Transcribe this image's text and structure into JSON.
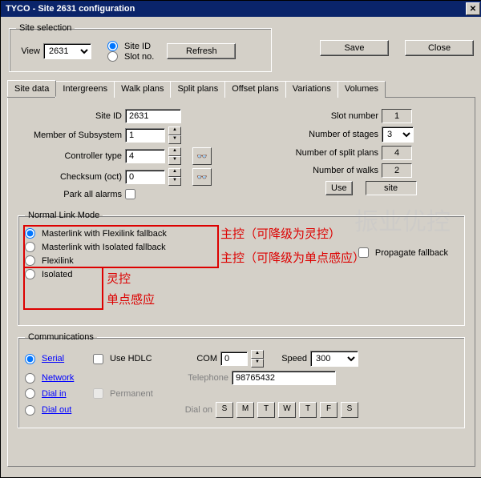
{
  "title": "TYCO - Site 2631 configuration",
  "site_selection": {
    "legend": "Site selection",
    "view_label": "View",
    "view_value": "2631",
    "siteid_label": "Site ID",
    "slotno_label": "Slot no.",
    "refresh": "Refresh"
  },
  "save": "Save",
  "close": "Close",
  "tabs": {
    "sitedata": "Site data",
    "intergr": "Intergreens",
    "walk": "Walk plans",
    "split": "Split plans",
    "offset": "Offset plans",
    "var": "Variations",
    "vol": "Volumes"
  },
  "fields": {
    "siteid_lbl": "Site ID",
    "siteid_val": "2631",
    "subsys_lbl": "Member of Subsystem",
    "subsys_val": "1",
    "ctrltype_lbl": "Controller type",
    "ctrltype_val": "4",
    "checksum_lbl": "Checksum (oct)",
    "checksum_val": "0",
    "park_lbl": "Park all alarms",
    "slot_lbl": "Slot number",
    "slot_val": "1",
    "stages_lbl": "Number of stages",
    "stages_val": "3",
    "splits_lbl": "Number of split plans",
    "splits_val": "4",
    "walks_lbl": "Number of walks",
    "walks_val": "2",
    "use_btn": "Use",
    "use_val": "site"
  },
  "linkmode": {
    "legend": "Normal Link Mode",
    "master_flex": "Masterlink with Flexilink fallback",
    "master_iso": "Masterlink with Isolated fallback",
    "flex": "Flexilink",
    "iso": "Isolated",
    "prop": "Propagate fallback"
  },
  "annot": {
    "a1": "主控（可降级为灵控）",
    "a2": "主控（可降级为单点感应）",
    "a3": "灵控",
    "a4": "单点感应"
  },
  "comms": {
    "legend": "Communications",
    "serial": "Serial",
    "usehdlc": "Use HDLC",
    "com_lbl": "COM",
    "com_val": "0",
    "speed_lbl": "Speed",
    "speed_val": "300",
    "network": "Network",
    "tel_lbl": "Telephone",
    "tel_val": "98765432",
    "dialin": "Dial in",
    "dialout": "Dial out",
    "perm": "Permanent",
    "dialon": "Dial on",
    "days": [
      "S",
      "M",
      "T",
      "W",
      "T",
      "F",
      "S"
    ]
  },
  "watermark": "振业优控"
}
